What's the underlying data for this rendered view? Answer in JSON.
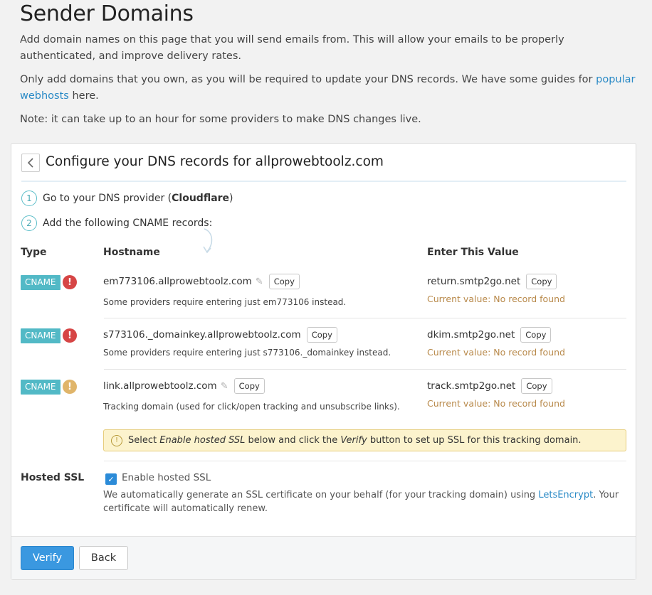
{
  "page": {
    "title": "Sender Domains",
    "intro1": "Add domain names on this page that you will send emails from. This will allow your emails to be properly authenticated, and improve delivery rates.",
    "intro2_before": "Only add domains that you own, as you will be required to update your DNS records. We have some guides for ",
    "intro2_link": "popular webhosts",
    "intro2_after": " here.",
    "note": "Note: it can take up to an hour for some providers to make DNS changes live."
  },
  "card": {
    "title": "Configure your DNS records for allprowebtoolz.com",
    "step1_num": "1",
    "step1_text": "Go to your DNS provider (",
    "step1_provider": "Cloudflare",
    "step1_close": ")",
    "step2_num": "2",
    "step2_text": "Add the following CNAME records:",
    "columns": {
      "type": "Type",
      "hostname": "Hostname",
      "value": "Enter This Value"
    },
    "copy_label": "Copy",
    "records": [
      {
        "type": "CNAME",
        "status": "error",
        "hostname": "em773106.allprowebtoolz.com",
        "hint": "Some providers require entering just em773106 instead.",
        "value": "return.smtp2go.net",
        "current": "Current value: No record found"
      },
      {
        "type": "CNAME",
        "status": "error",
        "hostname": "s773106._domainkey.allprowebtoolz.com",
        "hint": "Some providers require entering just s773106._domainkey instead.",
        "value": "dkim.smtp2go.net",
        "current": "Current value: No record found"
      },
      {
        "type": "CNAME",
        "status": "warning",
        "hostname": "link.allprowebtoolz.com",
        "hint": "Tracking domain (used for click/open tracking and unsubscribe links).",
        "value": "track.smtp2go.net",
        "current": "Current value: No record found"
      }
    ],
    "ssl_note": {
      "before": "Select ",
      "em1": "Enable hosted SSL",
      "middle": " below and click the ",
      "em2": "Verify",
      "after": " button to set up SSL for this tracking domain."
    },
    "hosted_ssl": {
      "label": "Hosted SSL",
      "checkbox_label": "Enable hosted SSL",
      "checked": true,
      "desc_before": "We automatically generate an SSL certificate on your behalf (for your tracking domain) using ",
      "desc_link": "LetsEncrypt",
      "desc_after": ". Your certificate will automatically renew."
    },
    "buttons": {
      "verify": "Verify",
      "back": "Back"
    }
  },
  "icons": {
    "back": "chevron-left-icon",
    "error": "exclamation-icon",
    "warning": "exclamation-icon",
    "edit": "pencil-icon",
    "info": "info-icon",
    "check": "check-icon"
  },
  "colors": {
    "badge": "#52b9c6",
    "error": "#d64545",
    "warning": "#e0b56a",
    "link": "#2a8ac6",
    "primary": "#3a98e0",
    "note_bg": "#fcf3cd",
    "current_value": "#b8894a"
  }
}
